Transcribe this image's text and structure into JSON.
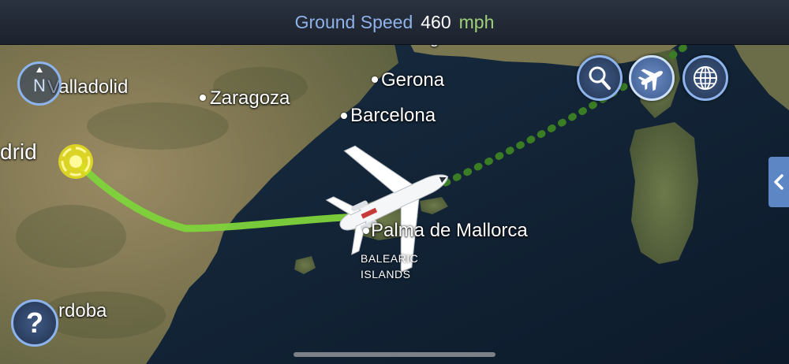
{
  "header": {
    "label": "Ground Speed",
    "value": "460",
    "unit": "mph"
  },
  "map": {
    "cities": {
      "valladolid": "Valladolid",
      "zaragoza": "Zaragoza",
      "gerona": "Gerona",
      "barcelona": "Barcelona",
      "madrid": "drid",
      "palma": "Palma de Mallorca",
      "cordoba": "rdoba",
      "top_fragment": "g"
    },
    "region_label": [
      "BALEARIC",
      "ISLANDS"
    ],
    "route_colors": {
      "flown": "#7ed33a",
      "remaining": "#3a7d25"
    }
  },
  "controls": {
    "compass_icon": "compass-north-icon",
    "search_icon": "magnifier-icon",
    "flight_icon": "airplane-icon",
    "globe_icon": "globe-icon",
    "help_symbol": "?",
    "sidetab_icon": "chevron-left-icon",
    "active_color": "#8db4ec"
  }
}
